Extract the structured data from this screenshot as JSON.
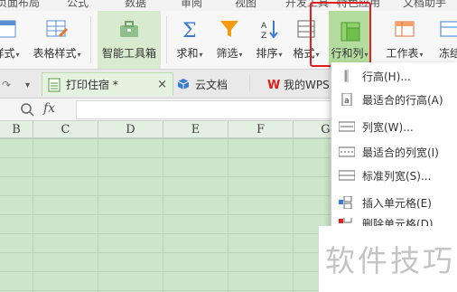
{
  "menubar": {
    "items": [
      "页面布局",
      "公式",
      "数据",
      "审阅",
      "视图",
      "开发工具",
      "特色应用",
      "文档助手"
    ]
  },
  "ribbon": {
    "buttons": [
      {
        "label": "样式",
        "has_caret": true
      },
      {
        "label": "表格样式",
        "has_caret": true
      },
      {
        "label": "智能工具箱",
        "has_caret": false
      },
      {
        "label": "求和",
        "has_caret": true
      },
      {
        "label": "筛选",
        "has_caret": true
      },
      {
        "label": "排序",
        "has_caret": true
      },
      {
        "label": "格式",
        "has_caret": true
      },
      {
        "label": "行和列",
        "has_caret": true
      },
      {
        "label": "工作表",
        "has_caret": true
      },
      {
        "label": "冻结"
      }
    ],
    "caret": "▾"
  },
  "tabbar": {
    "tabs": [
      {
        "label": "打印住宿 *",
        "active": true,
        "close": "×"
      },
      {
        "label": "云文档"
      },
      {
        "label": "我的WPS",
        "close": "×"
      }
    ],
    "undo_glyph": "↷",
    "dropdown_glyph": "▾"
  },
  "formula_bar": {
    "fx_label": "fx",
    "value": ""
  },
  "columns": [
    "B",
    "C",
    "D",
    "E",
    "F",
    "G"
  ],
  "dropdown": {
    "items": [
      {
        "label": "行高(H)..."
      },
      {
        "label": "最适合的行高(A)"
      },
      {
        "label": "列宽(W)..."
      },
      {
        "label": "最适合的列宽(I)"
      },
      {
        "label": "标准列宽(S)..."
      },
      {
        "label": "插入单元格(E)"
      },
      {
        "label": "删除单元格(D)"
      }
    ]
  },
  "watermark": "软件技巧",
  "colors": {
    "highlight": "#e02020",
    "sheet_bg": "#cde6cb",
    "accent_green": "#6fbf4a",
    "icon_blue": "#3a7bd5",
    "icon_orange": "#f39c12"
  }
}
